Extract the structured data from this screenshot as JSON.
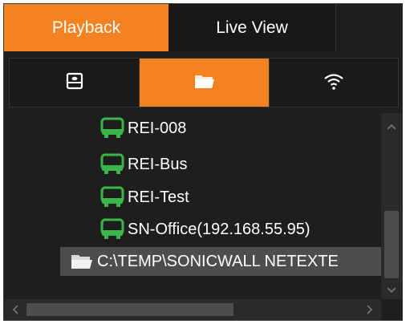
{
  "tabs": [
    {
      "label": "Playback",
      "active": true
    },
    {
      "label": "Live View",
      "active": false
    }
  ],
  "source_buttons": [
    {
      "icon": "drive-icon",
      "active": false
    },
    {
      "icon": "folder-icon",
      "active": true
    },
    {
      "icon": "wifi-icon",
      "active": false
    }
  ],
  "tree": {
    "items": [
      {
        "label": "REI-008",
        "icon": "bus-icon"
      },
      {
        "label": "REI-Bus",
        "icon": "bus-icon"
      },
      {
        "label": "REI-Test",
        "icon": "bus-icon"
      },
      {
        "label": "SN-Office(192.168.55.95)",
        "icon": "bus-icon"
      },
      {
        "label": "C:\\TEMP\\SONICWALL NETEXTE",
        "icon": "folder-icon",
        "selected": true
      }
    ]
  },
  "colors": {
    "accent": "#f58220",
    "bus_icon": "#39b54a",
    "panel_bg": "#1e1e1e",
    "selected_row": "#4d4d4d"
  }
}
